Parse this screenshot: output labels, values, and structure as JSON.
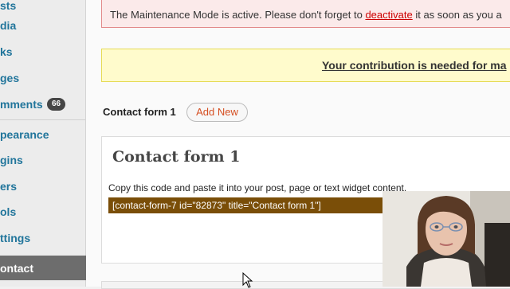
{
  "sidebar": {
    "items": [
      {
        "label": "sts"
      },
      {
        "label": "dia"
      },
      {
        "label": "ks"
      },
      {
        "label": "ges"
      },
      {
        "label": "mments",
        "badge": "66"
      },
      {
        "label": "pearance"
      },
      {
        "label": "gins"
      },
      {
        "label": "ers"
      },
      {
        "label": "ols"
      },
      {
        "label": "ttings"
      },
      {
        "label": "ontact",
        "active": true
      }
    ]
  },
  "notice": {
    "prefix": "The Maintenance Mode is active. Please don't forget to ",
    "link": "deactivate",
    "suffix": " it as soon as you a"
  },
  "banner": {
    "text": "Your contribution is needed for ma"
  },
  "page": {
    "title": "Contact form 1",
    "add_new": "Add New"
  },
  "form_box": {
    "title": "Contact form 1",
    "hint": "Copy this code and paste it into your post, page or text widget content.",
    "shortcode": "[contact-form-7 id=\"82873\" title=\"Contact form 1\"]"
  },
  "colors": {
    "link": "#21759b",
    "notice_border": "#e28a8a",
    "banner_bg": "#fffbcc",
    "shortcode_bg": "#7a4e08",
    "add_new": "#d54e21"
  },
  "icons": {
    "cursor": "mouse-pointer-icon"
  }
}
